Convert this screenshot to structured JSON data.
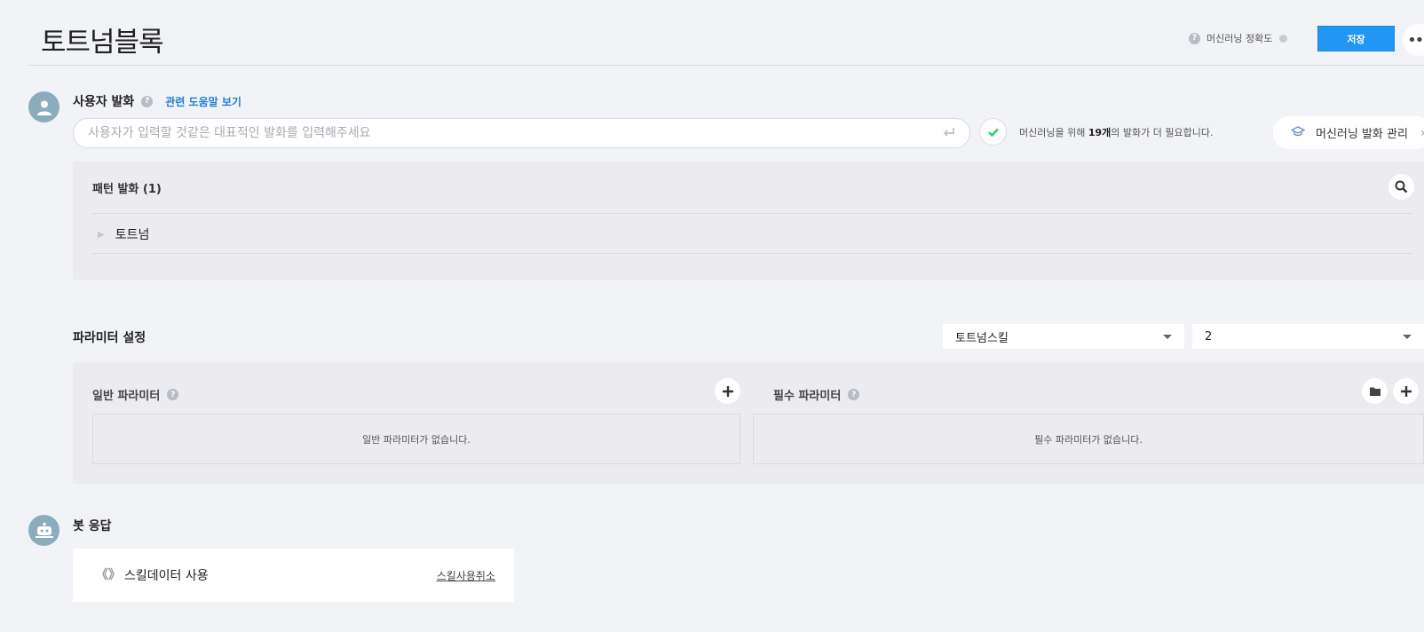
{
  "header": {
    "title": "토트넘블록",
    "ml_accuracy_label": "머신러닝 정확도",
    "save_label": "저장",
    "more_label": "•••"
  },
  "user_utterance": {
    "label": "사용자 발화",
    "help_link": "관련 도움말 보기",
    "input_placeholder": "사용자가 입력할 것같은 대표적인 발화를 입력해주세요",
    "input_value": "",
    "ml_notice_prefix": "머신러닝을 위해 ",
    "ml_notice_count": "19개",
    "ml_notice_suffix": "의 발화가 더 필요합니다.",
    "ml_manage_label": "머신러닝 발화 관리"
  },
  "pattern": {
    "title": "패턴 발화 (1)",
    "items": [
      "토트넘"
    ]
  },
  "parameters": {
    "title": "파라미터 설정",
    "select_skill": "토트넘스킬",
    "select_number": "2",
    "general_label": "일반 파라미터",
    "general_empty": "일반 파라미터가 없습니다.",
    "required_label": "필수 파라미터",
    "required_empty": "필수 파라미터가 없습니다."
  },
  "bot_response": {
    "label": "봇 응답",
    "brackets": "《》",
    "skill_data_label": "스킬데이터 사용",
    "cancel_label": "스킬사용취소"
  },
  "colors": {
    "primary": "#2196f3",
    "link": "#1e7fd6",
    "avatar": "#8aacbd",
    "check": "#2ecc71"
  }
}
